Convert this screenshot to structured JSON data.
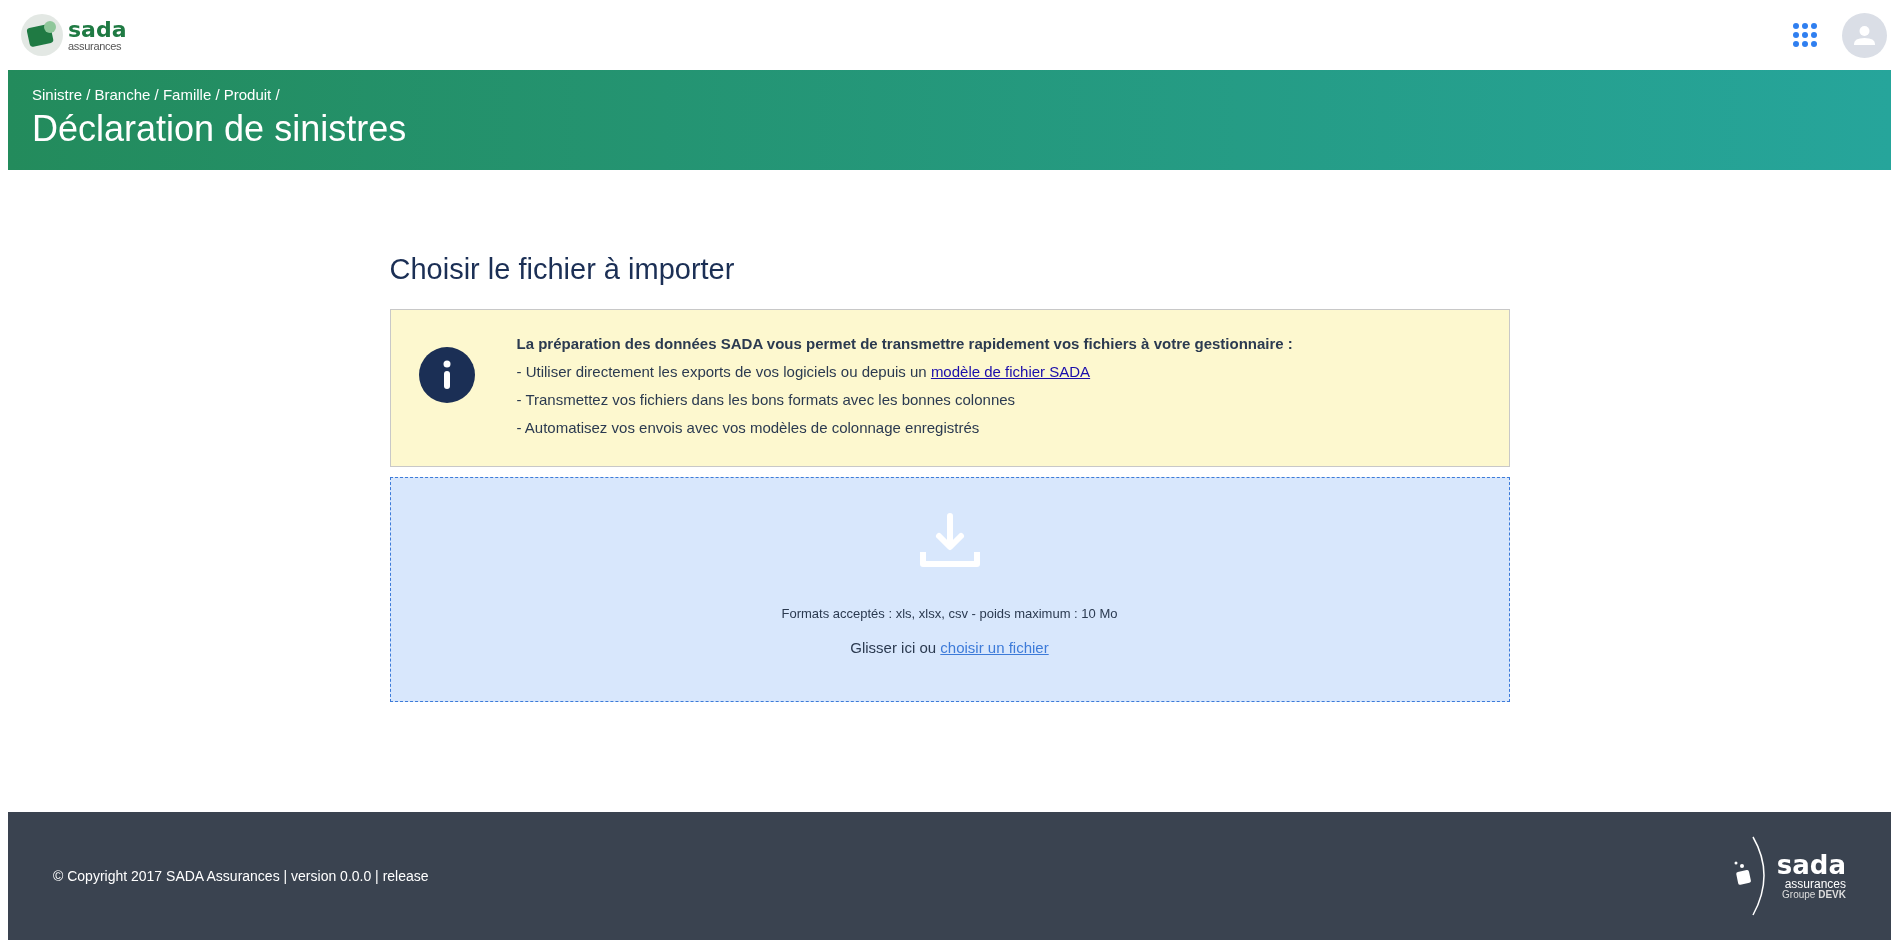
{
  "header": {
    "logo": {
      "name": "sada",
      "tagline": "assurances"
    }
  },
  "banner": {
    "breadcrumb": "Sinistre / Branche / Famille / Produit /",
    "title": "Déclaration de sinistres"
  },
  "main": {
    "heading": "Choisir le fichier à importer",
    "info": {
      "lead": "La préparation des données SADA vous permet de transmettre rapidement vos fichiers à votre gestionnaire :",
      "items": [
        {
          "text": "- Utiliser directement les exports de vos logiciels ou depuis un ",
          "link": "modèle de fichier SADA"
        },
        {
          "text": "- Transmettez vos fichiers dans les bons formats avec les bonnes colonnes"
        },
        {
          "text": "- Automatisez vos envois avec vos modèles de colonnage enregistrés"
        }
      ]
    },
    "dropzone": {
      "formats": "Formats acceptés : xls, xlsx, csv - poids maximum : 10 Mo",
      "prompt": "Glisser ici ou ",
      "link": "choisir un fichier"
    }
  },
  "footer": {
    "copyright": "© Copyright 2017 SADA Assurances | version 0.0.0 | release",
    "logo": {
      "name": "sada",
      "tagline": "assurances",
      "group": "Groupe",
      "group_name": "DEVK"
    }
  }
}
